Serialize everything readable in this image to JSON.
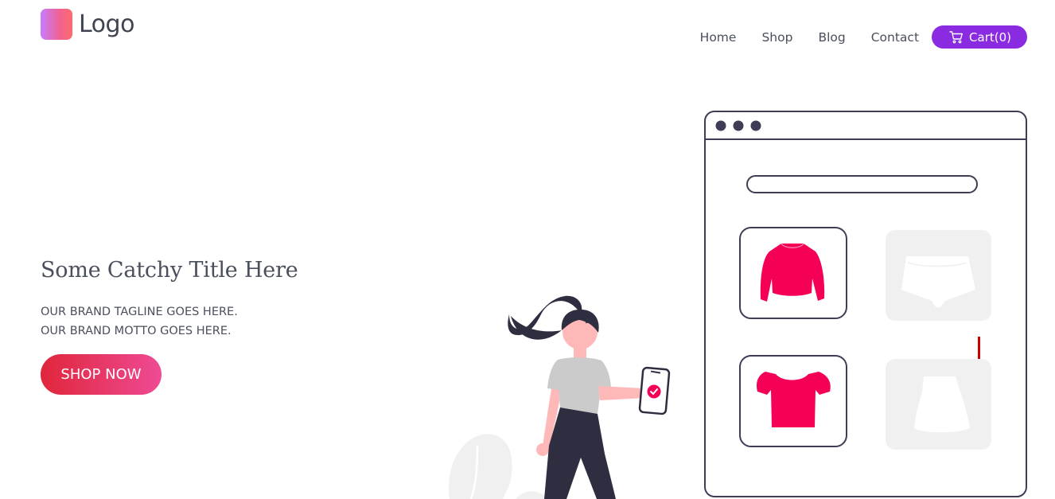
{
  "header": {
    "logo_text": "Logo",
    "nav": [
      "Home",
      "Shop",
      "Blog",
      "Contact"
    ],
    "cart_label": "Cart(0)"
  },
  "hero": {
    "title": "Some Catchy Title Here",
    "tagline": "OUR BRAND TAGLINE GOES HERE.",
    "motto": "OUR BRAND MOTTO GOES HERE.",
    "cta": "SHOP NOW"
  },
  "colors": {
    "accent_purple": "#8a2be2",
    "product_pink": "#f50057",
    "cta_gradient_start": "#e0263c",
    "cta_gradient_end": "#ef4b95",
    "dark": "#2f2e41"
  }
}
